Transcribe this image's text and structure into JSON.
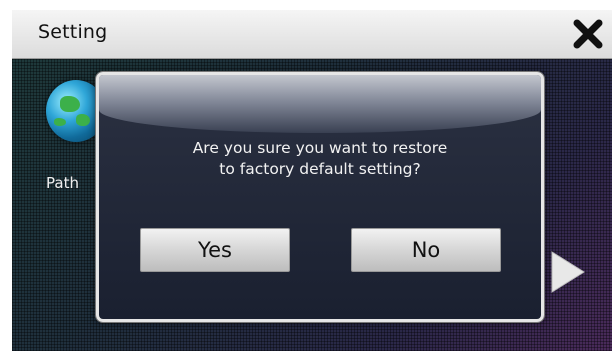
{
  "window": {
    "title": "Setting",
    "close_icon": "close-x-icon"
  },
  "background": {
    "app_icon": "globe-icon",
    "app_label": "Path",
    "next_icon": "play-arrow-right-icon"
  },
  "dialog": {
    "message_line1": "Are you sure you want to restore",
    "message_line2": "to factory default setting?",
    "yes_label": "Yes",
    "no_label": "No"
  },
  "colors": {
    "titlebar": "#e6e6e6",
    "dialog_bg": "#222838",
    "dialog_border": "#e6e6e6",
    "button_bg": "#d6d6d6"
  }
}
